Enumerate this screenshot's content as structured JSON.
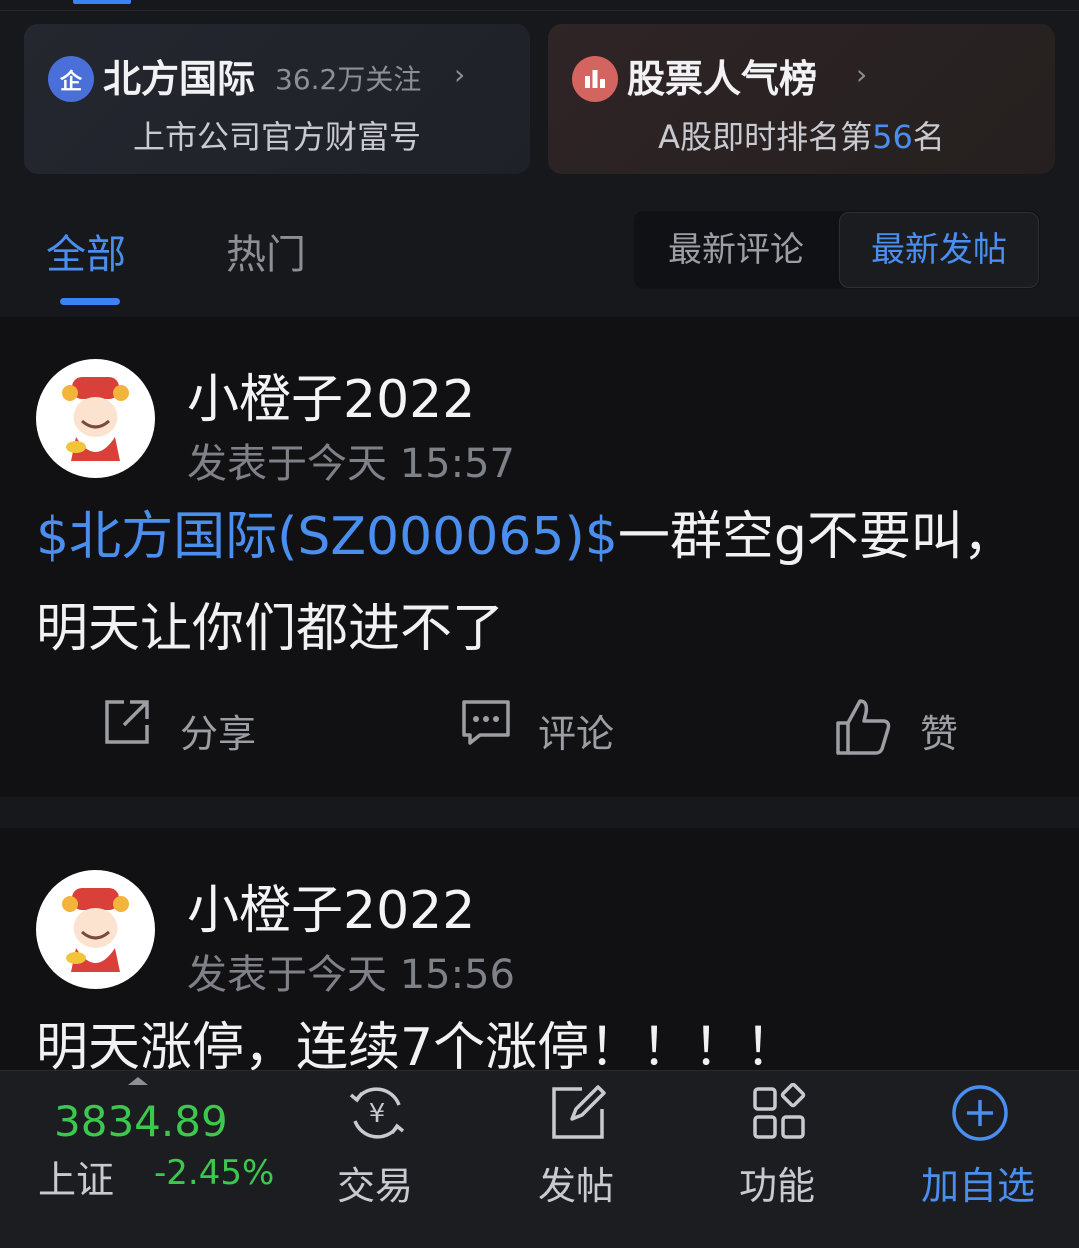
{
  "colors": {
    "accent": "#4a8ff0",
    "down": "#3cc84f",
    "background": "#17181b"
  },
  "company_card": {
    "logo_icon": "enterprise-icon",
    "logo_text": "企",
    "name": "北方国际",
    "followers": "36.2万关注",
    "subtitle": "上市公司官方财富号"
  },
  "rank_card": {
    "logo_icon": "ranking-chart-icon",
    "name": "股票人气榜",
    "subtitle_prefix": "A股即时排名第",
    "rank": "56",
    "subtitle_suffix": "名"
  },
  "tabs": {
    "all": "全部",
    "hot": "热门"
  },
  "sort": {
    "latest_comment": "最新评论",
    "latest_post": "最新发帖",
    "selected": "最新发帖"
  },
  "posts": [
    {
      "author": "小橙子2022",
      "time": "发表于今天 15:57",
      "stock_tag": "$北方国际(SZ000065)$",
      "text_line1": "一群空g不要叫，",
      "text_line2": "明天让你们都进不了",
      "actions": {
        "share": "分享",
        "comment": "评论",
        "like": "赞"
      }
    },
    {
      "author": "小橙子2022",
      "time": "发表于今天 15:56",
      "text_line1": "明天涨停，连续7个涨停！！！！"
    }
  ],
  "bottom_bar": {
    "index_value": "3834.89",
    "index_name": "上证",
    "index_change": "-2.45%",
    "trade": "交易",
    "post": "发帖",
    "functions": "功能",
    "add_watchlist": "加自选"
  }
}
